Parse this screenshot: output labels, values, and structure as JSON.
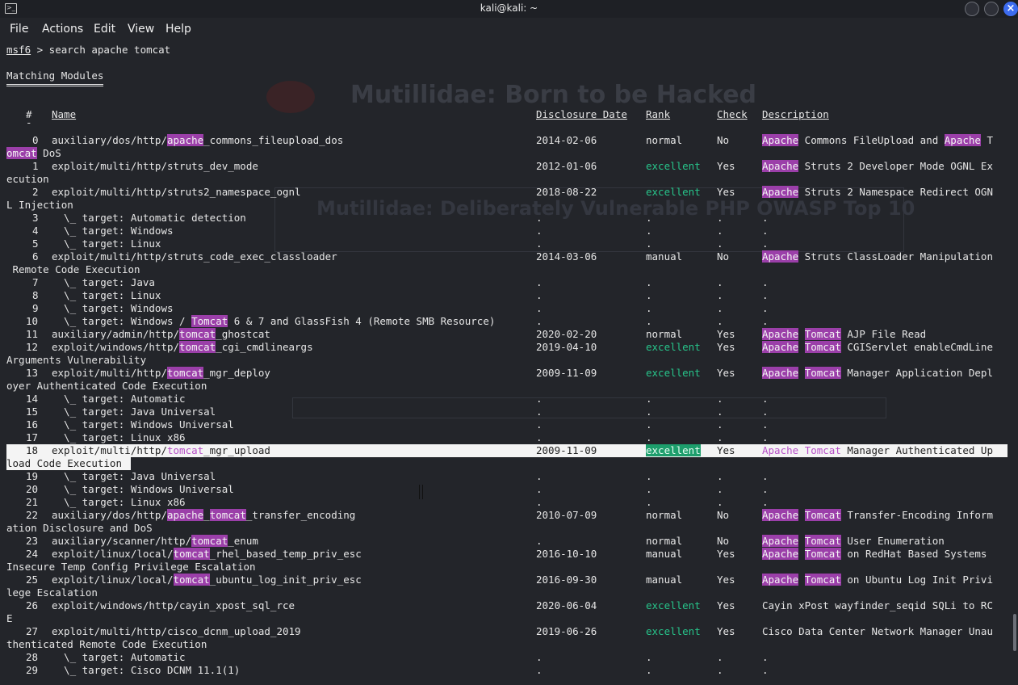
{
  "window": {
    "title": "kali@kali: ~"
  },
  "menu": [
    "File",
    "Actions",
    "Edit",
    "View",
    "Help"
  ],
  "ghost": {
    "heading": "Mutillidae: Born to be Hacked",
    "sub": "Mutillidae: Deliberately Vulnerable PHP OWASP Top 10"
  },
  "prompt": {
    "prefix": "msf6",
    "command": " > search apache tomcat"
  },
  "section_title": "Matching Modules",
  "headers": {
    "num": "#",
    "name": "Name",
    "date": "Disclosure Date",
    "rank": "Rank",
    "check": "Check",
    "desc": "Description"
  },
  "rows": [
    {
      "n": "0",
      "name": "auxiliary/dos/http/apache_commons_fileupload_dos",
      "date": "2014-02-06",
      "rank": "normal",
      "check": "No",
      "desc": "Apache Commons FileUpload and Apache T",
      "wrap": "omcat DoS"
    },
    {
      "n": "1",
      "name": "exploit/multi/http/struts_dev_mode",
      "date": "2012-01-06",
      "rank": "excellent",
      "check": "Yes",
      "desc": "Apache Struts 2 Developer Mode OGNL Ex",
      "wrap": "ecution"
    },
    {
      "n": "2",
      "name": "exploit/multi/http/struts2_namespace_ognl",
      "date": "2018-08-22",
      "rank": "excellent",
      "check": "Yes",
      "desc": "Apache Struts 2 Namespace Redirect OGN",
      "wrap": "L Injection"
    },
    {
      "n": "3",
      "name": "  \\_ target: Automatic detection",
      "date": ".",
      "rank": ".",
      "check": ".",
      "desc": "."
    },
    {
      "n": "4",
      "name": "  \\_ target: Windows",
      "date": ".",
      "rank": ".",
      "check": ".",
      "desc": "."
    },
    {
      "n": "5",
      "name": "  \\_ target: Linux",
      "date": ".",
      "rank": ".",
      "check": ".",
      "desc": "."
    },
    {
      "n": "6",
      "name": "exploit/multi/http/struts_code_exec_classloader",
      "date": "2014-03-06",
      "rank": "manual",
      "check": "No",
      "desc": "Apache Struts ClassLoader Manipulation",
      "wrap": " Remote Code Execution"
    },
    {
      "n": "7",
      "name": "  \\_ target: Java",
      "date": ".",
      "rank": ".",
      "check": ".",
      "desc": "."
    },
    {
      "n": "8",
      "name": "  \\_ target: Linux",
      "date": ".",
      "rank": ".",
      "check": ".",
      "desc": "."
    },
    {
      "n": "9",
      "name": "  \\_ target: Windows",
      "date": ".",
      "rank": ".",
      "check": ".",
      "desc": "."
    },
    {
      "n": "10",
      "name": "  \\_ target: Windows / Tomcat 6 & 7 and GlassFish 4 (Remote SMB Resource)",
      "date": ".",
      "rank": ".",
      "check": ".",
      "desc": "."
    },
    {
      "n": "11",
      "name": "auxiliary/admin/http/tomcat_ghostcat",
      "date": "2020-02-20",
      "rank": "normal",
      "check": "Yes",
      "desc": "Apache Tomcat AJP File Read"
    },
    {
      "n": "12",
      "name": "exploit/windows/http/tomcat_cgi_cmdlineargs",
      "date": "2019-04-10",
      "rank": "excellent",
      "check": "Yes",
      "desc": "Apache Tomcat CGIServlet enableCmdLine",
      "wrap": "Arguments Vulnerability"
    },
    {
      "n": "13",
      "name": "exploit/multi/http/tomcat_mgr_deploy",
      "date": "2009-11-09",
      "rank": "excellent",
      "check": "Yes",
      "desc": "Apache Tomcat Manager Application Depl",
      "wrap": "oyer Authenticated Code Execution"
    },
    {
      "n": "14",
      "name": "  \\_ target: Automatic",
      "date": ".",
      "rank": ".",
      "check": ".",
      "desc": "."
    },
    {
      "n": "15",
      "name": "  \\_ target: Java Universal",
      "date": ".",
      "rank": ".",
      "check": ".",
      "desc": "."
    },
    {
      "n": "16",
      "name": "  \\_ target: Windows Universal",
      "date": ".",
      "rank": ".",
      "check": ".",
      "desc": "."
    },
    {
      "n": "17",
      "name": "  \\_ target: Linux x86",
      "date": ".",
      "rank": ".",
      "check": ".",
      "desc": "."
    },
    {
      "n": "18",
      "name": "exploit/multi/http/tomcat_mgr_upload",
      "date": "2009-11-09",
      "rank": "excellent",
      "check": "Yes",
      "desc": "Apache Tomcat Manager Authenticated Up",
      "wrap": "load Code Execution"
    },
    {
      "n": "19",
      "name": "  \\_ target: Java Universal",
      "date": ".",
      "rank": ".",
      "check": ".",
      "desc": "."
    },
    {
      "n": "20",
      "name": "  \\_ target: Windows Universal",
      "date": ".",
      "rank": ".",
      "check": ".",
      "desc": "."
    },
    {
      "n": "21",
      "name": "  \\_ target: Linux x86",
      "date": ".",
      "rank": ".",
      "check": ".",
      "desc": "."
    },
    {
      "n": "22",
      "name": "auxiliary/dos/http/apache_tomcat_transfer_encoding",
      "date": "2010-07-09",
      "rank": "normal",
      "check": "No",
      "desc": "Apache Tomcat Transfer-Encoding Inform",
      "wrap": "ation Disclosure and DoS"
    },
    {
      "n": "23",
      "name": "auxiliary/scanner/http/tomcat_enum",
      "date": ".",
      "rank": "normal",
      "check": "No",
      "desc": "Apache Tomcat User Enumeration"
    },
    {
      "n": "24",
      "name": "exploit/linux/local/tomcat_rhel_based_temp_priv_esc",
      "date": "2016-10-10",
      "rank": "manual",
      "check": "Yes",
      "desc": "Apache Tomcat on RedHat Based Systems",
      "wrap": "Insecure Temp Config Privilege Escalation"
    },
    {
      "n": "25",
      "name": "exploit/linux/local/tomcat_ubuntu_log_init_priv_esc",
      "date": "2016-09-30",
      "rank": "manual",
      "check": "Yes",
      "desc": "Apache Tomcat on Ubuntu Log Init Privi",
      "wrap": "lege Escalation"
    },
    {
      "n": "26",
      "name": "exploit/windows/http/cayin_xpost_sql_rce",
      "date": "2020-06-04",
      "rank": "excellent",
      "check": "Yes",
      "desc": "Cayin xPost wayfinder_seqid SQLi to RC",
      "wrap": "E"
    },
    {
      "n": "27",
      "name": "exploit/multi/http/cisco_dcnm_upload_2019",
      "date": "2019-06-26",
      "rank": "excellent",
      "check": "Yes",
      "desc": "Cisco Data Center Network Manager Unau",
      "wrap": "thenticated Remote Code Execution"
    },
    {
      "n": "28",
      "name": "  \\_ target: Automatic",
      "date": ".",
      "rank": ".",
      "check": ".",
      "desc": "."
    },
    {
      "n": "29",
      "name": "  \\_ target: Cisco DCNM 11.1(1)",
      "date": ".",
      "rank": ".",
      "check": ".",
      "desc": "."
    }
  ],
  "selected_row": "18",
  "colors": {
    "highlight": "#9b3fa9",
    "excellent": "#27c48a",
    "background": "#1e2026"
  }
}
